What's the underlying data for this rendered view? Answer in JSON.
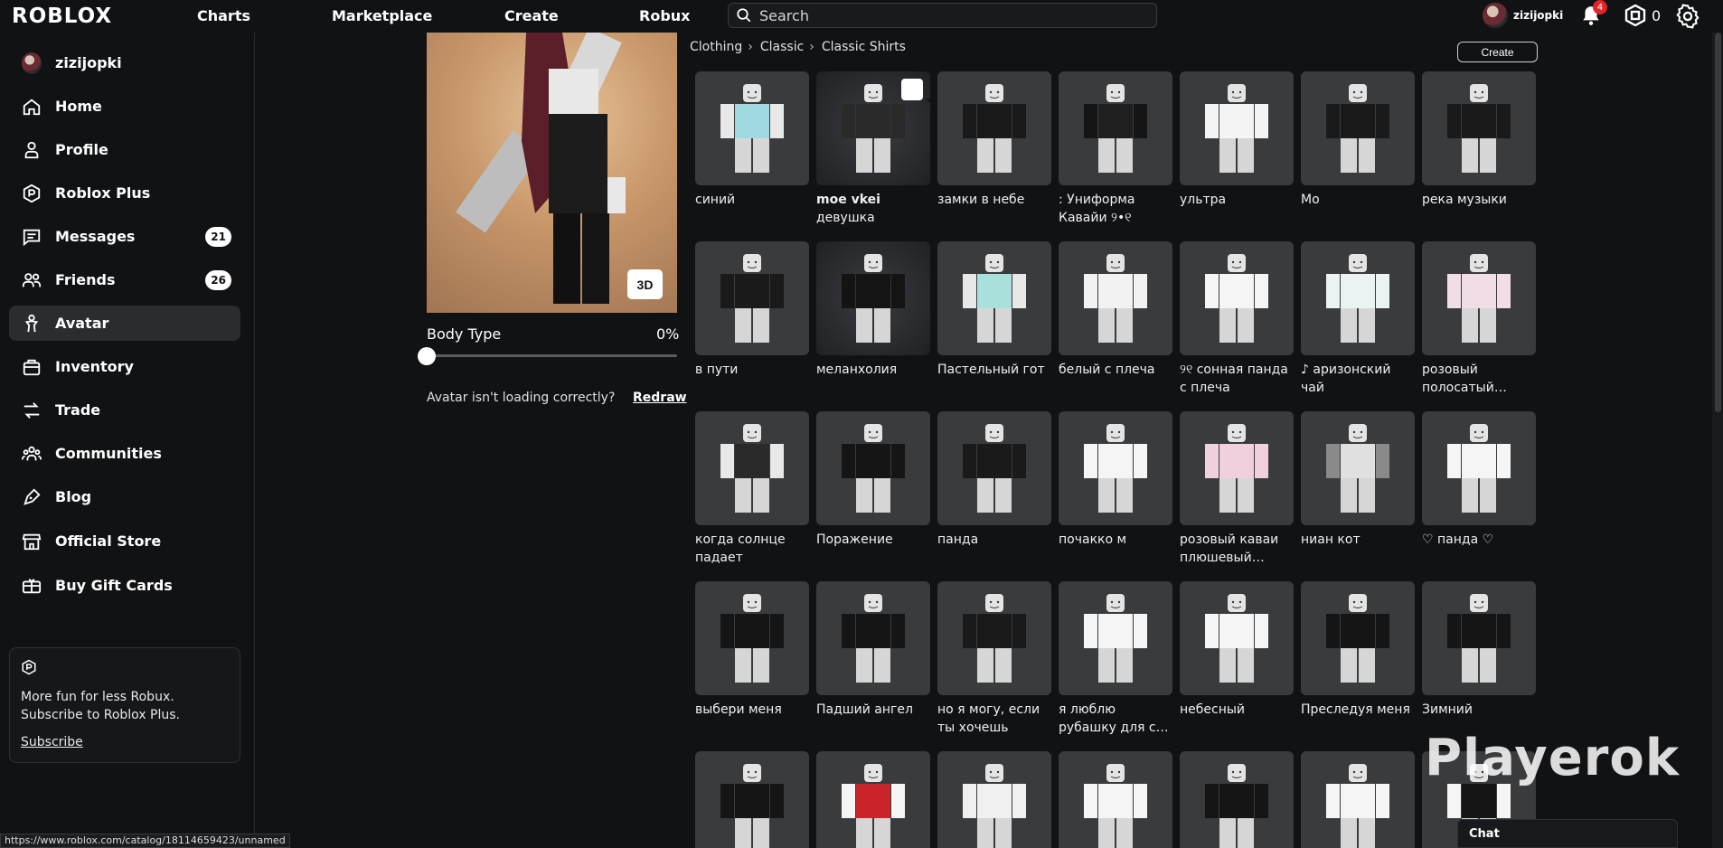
{
  "topbar": {
    "logo": "ROBLOX",
    "nav": [
      "Charts",
      "Marketplace",
      "Create",
      "Robux"
    ],
    "search_placeholder": "Search",
    "username": "zizijopki",
    "notifications": "4",
    "robux": "0"
  },
  "sidebar": {
    "username": "zizijopki",
    "items": [
      {
        "label": "Home",
        "icon": "home-icon"
      },
      {
        "label": "Profile",
        "icon": "profile-icon"
      },
      {
        "label": "Roblox Plus",
        "icon": "roblox-plus-icon"
      },
      {
        "label": "Messages",
        "icon": "messages-icon",
        "count": "21"
      },
      {
        "label": "Friends",
        "icon": "friends-icon",
        "count": "26"
      },
      {
        "label": "Avatar",
        "icon": "avatar-icon"
      },
      {
        "label": "Inventory",
        "icon": "inventory-icon"
      },
      {
        "label": "Trade",
        "icon": "trade-icon"
      },
      {
        "label": "Communities",
        "icon": "communities-icon"
      },
      {
        "label": "Blog",
        "icon": "blog-icon"
      },
      {
        "label": "Official Store",
        "icon": "store-icon"
      },
      {
        "label": "Buy Gift Cards",
        "icon": "gift-card-icon"
      }
    ],
    "promo_text": "More fun for less Robux. Subscribe to Roblox Plus.",
    "promo_link": "Subscribe"
  },
  "status_url": "https://www.roblox.com/catalog/18114659423/unnamed",
  "avatar_panel": {
    "btn_3d": "3D",
    "body_type_label": "Body Type",
    "body_type_value": "0%",
    "body_type_level": 0,
    "loading_text": "Avatar isn't loading correctly?",
    "redraw": "Redraw"
  },
  "breadcrumb": [
    "Clothing",
    "Classic",
    "Classic Shirts"
  ],
  "create_label": "Create",
  "items": [
    {
      "name": "синий",
      "torso": "#9fd8e0",
      "arms": "#e8e8e8"
    },
    {
      "bold": "moe vkei",
      "name": " девушка",
      "torso": "#2a2a2a",
      "arms": "#2a2a2a",
      "selected": true,
      "dark": true
    },
    {
      "name": "замки в небе",
      "torso": "#1a1a1a",
      "arms": "#1a1a1a"
    },
    {
      "name": ": Униформа Кавайи ୨•୧",
      "torso": "#202020",
      "arms": "#151515"
    },
    {
      "name": "ультра",
      "torso": "#f4f4f4",
      "arms": "#f4f4f4"
    },
    {
      "name": "Мо",
      "torso": "#1a1a1a",
      "arms": "#1a1a1a"
    },
    {
      "name": "река музыки",
      "torso": "#1a1a1a",
      "arms": "#1a1a1a"
    },
    {
      "name": "в пути",
      "torso": "#1a1a1a",
      "arms": "#1a1a1a"
    },
    {
      "name": "меланхолия",
      "torso": "#141414",
      "arms": "#141414",
      "dark": true
    },
    {
      "name": "Пастельный гот",
      "torso": "#a8e0dc",
      "arms": "#e8e8e8"
    },
    {
      "name": "белый с плеча",
      "torso": "#f2f2f2",
      "arms": "#f2f2f2"
    },
    {
      "name": "୨୧ сонная панда с плеча",
      "torso": "#f5f5f5",
      "arms": "#f5f5f5"
    },
    {
      "name": "♪ аризонский чай",
      "torso": "#eaf2f2",
      "arms": "#eaf2f2"
    },
    {
      "name": "розовый полосатый бант...",
      "torso": "#f0dde6",
      "arms": "#f0dde6"
    },
    {
      "name": "когда солнце падает",
      "torso": "#2a2a2a",
      "arms": "#e8e8e8"
    },
    {
      "name": "Поражение",
      "torso": "#151515",
      "arms": "#151515"
    },
    {
      "name": "панда",
      "torso": "#1a1a1a",
      "arms": "#1a1a1a"
    },
    {
      "name": "почакко м",
      "torso": "#f5f5f5",
      "arms": "#f5f5f5"
    },
    {
      "name": "розовый каваи плюшевый мишк...",
      "torso": "#f0d0dc",
      "arms": "#f0d0dc"
    },
    {
      "name": "ниан кот",
      "torso": "#e0e0e0",
      "arms": "#8a8a8a"
    },
    {
      "name": "♡ панда ♡",
      "torso": "#f5f5f5",
      "arms": "#f5f5f5"
    },
    {
      "name": "выбери меня",
      "torso": "#151515",
      "arms": "#151515"
    },
    {
      "name": "Падший ангел",
      "torso": "#151515",
      "arms": "#151515"
    },
    {
      "name": "но я могу, если ты хочешь",
      "torso": "#1a1a1a",
      "arms": "#1a1a1a"
    },
    {
      "name": "я люблю рубашку для сна (g)",
      "torso": "#f5f5f5",
      "arms": "#f5f5f5"
    },
    {
      "name": "небесный",
      "torso": "#f5f5f5",
      "arms": "#f5f5f5"
    },
    {
      "name": "Преследуя меня",
      "torso": "#151515",
      "arms": "#151515"
    },
    {
      "name": "Зимний",
      "torso": "#151515",
      "arms": "#151515"
    },
    {
      "name": "",
      "torso": "#151515",
      "arms": "#151515"
    },
    {
      "name": "",
      "torso": "#c8242a",
      "arms": "#f5f5f5"
    },
    {
      "name": "",
      "torso": "#f0f0f0",
      "arms": "#f0f0f0"
    },
    {
      "name": "",
      "torso": "#f5f5f5",
      "arms": "#f5f5f5"
    },
    {
      "name": "",
      "torso": "#151515",
      "arms": "#151515"
    },
    {
      "name": "",
      "torso": "#f5f5f5",
      "arms": "#f5f5f5"
    },
    {
      "name": "",
      "torso": "#151515",
      "arms": "#f5f5f5"
    }
  ],
  "watermark": "Playerok",
  "chat_label": "Chat"
}
